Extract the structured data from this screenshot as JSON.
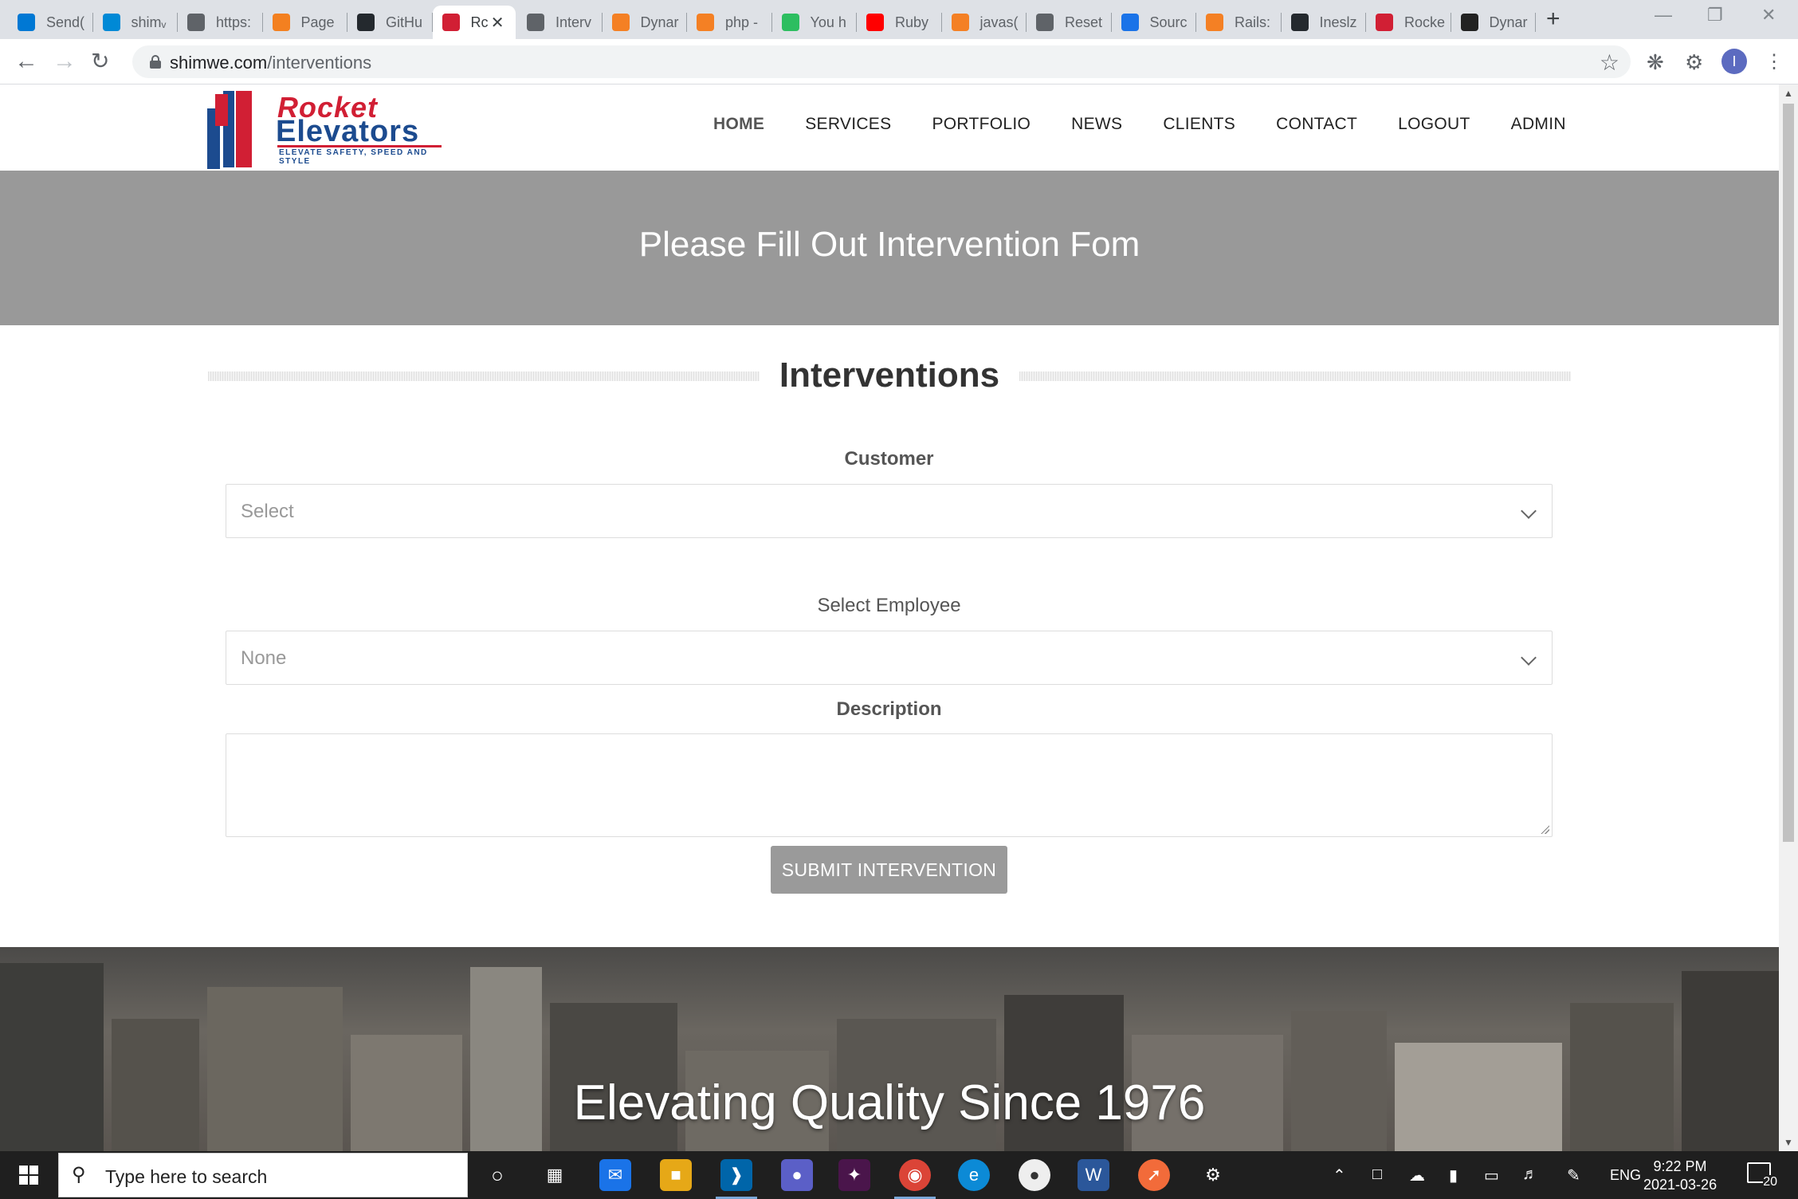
{
  "browser": {
    "tabs": [
      {
        "title": "Send(",
        "icon": "send-icon",
        "color": "#0078d4"
      },
      {
        "title": "shimᵥ",
        "icon": "azure-icon",
        "color": "#0089d6"
      },
      {
        "title": "https:",
        "icon": "globe-icon",
        "color": "#5f6368"
      },
      {
        "title": "Page",
        "icon": "cloudflare-icon",
        "color": "#f38020"
      },
      {
        "title": "GitHu",
        "icon": "github-icon",
        "color": "#24292e"
      },
      {
        "title": "Rc",
        "icon": "rocket-elevators-icon",
        "color": "#d11f34",
        "active": true
      },
      {
        "title": "Interv",
        "icon": "globe-icon",
        "color": "#5f6368"
      },
      {
        "title": "Dynar",
        "icon": "stackoverflow-icon",
        "color": "#f48024"
      },
      {
        "title": "php -",
        "icon": "stackoverflow-icon",
        "color": "#f48024"
      },
      {
        "title": "You h",
        "icon": "evernote-icon",
        "color": "#2dbe60"
      },
      {
        "title": "Ruby",
        "icon": "youtube-icon",
        "color": "#ff0000"
      },
      {
        "title": "javas(",
        "icon": "stackoverflow-icon",
        "color": "#f48024"
      },
      {
        "title": "Reset",
        "icon": "globe-icon",
        "color": "#5f6368"
      },
      {
        "title": "Sourc",
        "icon": "maps-pin-icon",
        "color": "#1a73e8"
      },
      {
        "title": "Rails:",
        "icon": "stackoverflow-icon",
        "color": "#f48024"
      },
      {
        "title": "Ineslz",
        "icon": "github-icon",
        "color": "#24292e"
      },
      {
        "title": "Rocke",
        "icon": "rocket-elevators-icon",
        "color": "#d11f34"
      },
      {
        "title": "Dynar",
        "icon": "hashbang-icon",
        "color": "#222222"
      }
    ],
    "url_host": "shimwe.com",
    "url_path": "/interventions",
    "profile_initial": "I"
  },
  "site": {
    "logo": {
      "word1": "Rocket",
      "word2": "Elevators",
      "tagline": "ELEVATE SAFETY, SPEED AND STYLE"
    },
    "nav": [
      "HOME",
      "SERVICES",
      "PORTFOLIO",
      "NEWS",
      "CLIENTS",
      "CONTACT",
      "LOGOUT",
      "ADMIN"
    ],
    "hero_title": "Please Fill Out Intervention Fom",
    "section_title": "Interventions",
    "form": {
      "customer_label": "Customer",
      "customer_value": "Select",
      "employee_label": "Select Employee",
      "employee_value": "None",
      "description_label": "Description",
      "description_value": "",
      "submit_label": "SUBMIT INTERVENTION"
    },
    "banner_title": "Elevating Quality Since 1976"
  },
  "taskbar": {
    "search_placeholder": "Type here to search",
    "language": "ENG",
    "time": "9:22 PM",
    "date": "2021-03-26",
    "notification_count": "20"
  }
}
